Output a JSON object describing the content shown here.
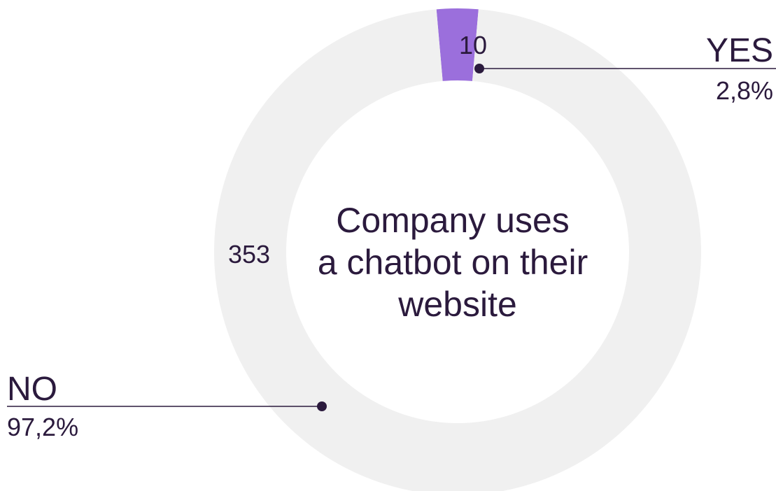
{
  "chart_data": {
    "type": "pie",
    "variant": "donut",
    "title_lines": [
      "Company uses",
      "a chatbot on their",
      "website"
    ],
    "categories": [
      "YES",
      "NO"
    ],
    "values": [
      10,
      353
    ],
    "percent_labels": [
      "2,8%",
      "97,2%"
    ],
    "value_labels": [
      "10",
      "353"
    ],
    "colors": {
      "YES": "#9b6fdc",
      "NO": "#f0f0f0",
      "text": "#2b1a3d",
      "leader": "#2b1a3d"
    }
  }
}
